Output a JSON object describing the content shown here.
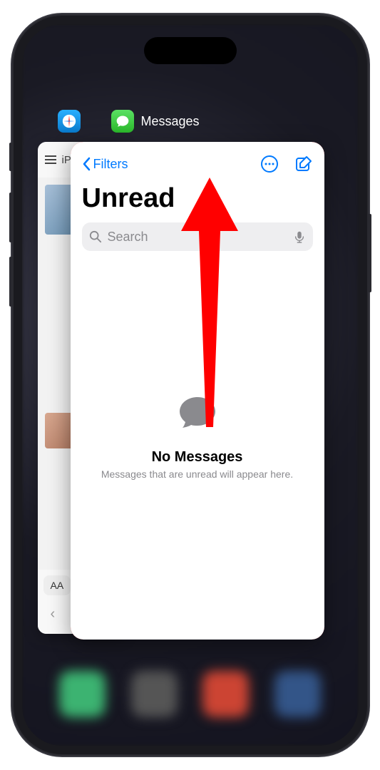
{
  "switcher": {
    "apps": {
      "safari": {
        "label": "Safari",
        "toolbar_text": "iP",
        "aa_label": "AA"
      },
      "messages": {
        "label": "Messages"
      }
    }
  },
  "messages": {
    "back_label": "Filters",
    "title": "Unread",
    "search_placeholder": "Search",
    "empty_title": "No Messages",
    "empty_subtitle": "Messages that are unread will appear here."
  },
  "annotation": {
    "highlight_color": "#ff0000",
    "arrow_direction": "up"
  }
}
